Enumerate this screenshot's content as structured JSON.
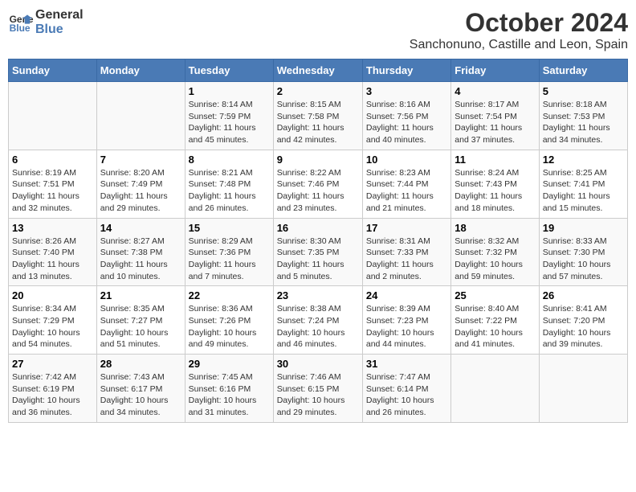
{
  "logo": {
    "line1": "General",
    "line2": "Blue"
  },
  "title": "October 2024",
  "subtitle": "Sanchonuno, Castille and Leon, Spain",
  "headers": [
    "Sunday",
    "Monday",
    "Tuesday",
    "Wednesday",
    "Thursday",
    "Friday",
    "Saturday"
  ],
  "weeks": [
    [
      {
        "day": "",
        "info": ""
      },
      {
        "day": "",
        "info": ""
      },
      {
        "day": "1",
        "info": "Sunrise: 8:14 AM\nSunset: 7:59 PM\nDaylight: 11 hours and 45 minutes."
      },
      {
        "day": "2",
        "info": "Sunrise: 8:15 AM\nSunset: 7:58 PM\nDaylight: 11 hours and 42 minutes."
      },
      {
        "day": "3",
        "info": "Sunrise: 8:16 AM\nSunset: 7:56 PM\nDaylight: 11 hours and 40 minutes."
      },
      {
        "day": "4",
        "info": "Sunrise: 8:17 AM\nSunset: 7:54 PM\nDaylight: 11 hours and 37 minutes."
      },
      {
        "day": "5",
        "info": "Sunrise: 8:18 AM\nSunset: 7:53 PM\nDaylight: 11 hours and 34 minutes."
      }
    ],
    [
      {
        "day": "6",
        "info": "Sunrise: 8:19 AM\nSunset: 7:51 PM\nDaylight: 11 hours and 32 minutes."
      },
      {
        "day": "7",
        "info": "Sunrise: 8:20 AM\nSunset: 7:49 PM\nDaylight: 11 hours and 29 minutes."
      },
      {
        "day": "8",
        "info": "Sunrise: 8:21 AM\nSunset: 7:48 PM\nDaylight: 11 hours and 26 minutes."
      },
      {
        "day": "9",
        "info": "Sunrise: 8:22 AM\nSunset: 7:46 PM\nDaylight: 11 hours and 23 minutes."
      },
      {
        "day": "10",
        "info": "Sunrise: 8:23 AM\nSunset: 7:44 PM\nDaylight: 11 hours and 21 minutes."
      },
      {
        "day": "11",
        "info": "Sunrise: 8:24 AM\nSunset: 7:43 PM\nDaylight: 11 hours and 18 minutes."
      },
      {
        "day": "12",
        "info": "Sunrise: 8:25 AM\nSunset: 7:41 PM\nDaylight: 11 hours and 15 minutes."
      }
    ],
    [
      {
        "day": "13",
        "info": "Sunrise: 8:26 AM\nSunset: 7:40 PM\nDaylight: 11 hours and 13 minutes."
      },
      {
        "day": "14",
        "info": "Sunrise: 8:27 AM\nSunset: 7:38 PM\nDaylight: 11 hours and 10 minutes."
      },
      {
        "day": "15",
        "info": "Sunrise: 8:29 AM\nSunset: 7:36 PM\nDaylight: 11 hours and 7 minutes."
      },
      {
        "day": "16",
        "info": "Sunrise: 8:30 AM\nSunset: 7:35 PM\nDaylight: 11 hours and 5 minutes."
      },
      {
        "day": "17",
        "info": "Sunrise: 8:31 AM\nSunset: 7:33 PM\nDaylight: 11 hours and 2 minutes."
      },
      {
        "day": "18",
        "info": "Sunrise: 8:32 AM\nSunset: 7:32 PM\nDaylight: 10 hours and 59 minutes."
      },
      {
        "day": "19",
        "info": "Sunrise: 8:33 AM\nSunset: 7:30 PM\nDaylight: 10 hours and 57 minutes."
      }
    ],
    [
      {
        "day": "20",
        "info": "Sunrise: 8:34 AM\nSunset: 7:29 PM\nDaylight: 10 hours and 54 minutes."
      },
      {
        "day": "21",
        "info": "Sunrise: 8:35 AM\nSunset: 7:27 PM\nDaylight: 10 hours and 51 minutes."
      },
      {
        "day": "22",
        "info": "Sunrise: 8:36 AM\nSunset: 7:26 PM\nDaylight: 10 hours and 49 minutes."
      },
      {
        "day": "23",
        "info": "Sunrise: 8:38 AM\nSunset: 7:24 PM\nDaylight: 10 hours and 46 minutes."
      },
      {
        "day": "24",
        "info": "Sunrise: 8:39 AM\nSunset: 7:23 PM\nDaylight: 10 hours and 44 minutes."
      },
      {
        "day": "25",
        "info": "Sunrise: 8:40 AM\nSunset: 7:22 PM\nDaylight: 10 hours and 41 minutes."
      },
      {
        "day": "26",
        "info": "Sunrise: 8:41 AM\nSunset: 7:20 PM\nDaylight: 10 hours and 39 minutes."
      }
    ],
    [
      {
        "day": "27",
        "info": "Sunrise: 7:42 AM\nSunset: 6:19 PM\nDaylight: 10 hours and 36 minutes."
      },
      {
        "day": "28",
        "info": "Sunrise: 7:43 AM\nSunset: 6:17 PM\nDaylight: 10 hours and 34 minutes."
      },
      {
        "day": "29",
        "info": "Sunrise: 7:45 AM\nSunset: 6:16 PM\nDaylight: 10 hours and 31 minutes."
      },
      {
        "day": "30",
        "info": "Sunrise: 7:46 AM\nSunset: 6:15 PM\nDaylight: 10 hours and 29 minutes."
      },
      {
        "day": "31",
        "info": "Sunrise: 7:47 AM\nSunset: 6:14 PM\nDaylight: 10 hours and 26 minutes."
      },
      {
        "day": "",
        "info": ""
      },
      {
        "day": "",
        "info": ""
      }
    ]
  ]
}
